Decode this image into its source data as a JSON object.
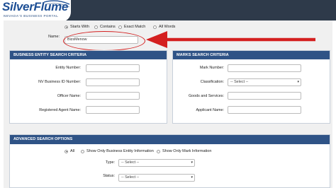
{
  "logo": {
    "title": "SilverFlume",
    "subtitle": "NEVADA'S BUSINESS PORTAL"
  },
  "search_type": {
    "options": [
      "Starts With",
      "Contains",
      "Exact Match",
      "All Words"
    ],
    "selected": "Starts With"
  },
  "name": {
    "label": "Name:",
    "value": "BizsMenow"
  },
  "business_entity": {
    "header": "BUSINESS ENTITY SEARCH CRITERIA",
    "entity_number": "Entity Number:",
    "nv_business_id": "NV Business ID Number:",
    "officer_name": "Officer Name:",
    "registered_agent": "Registered Agent Name:"
  },
  "marks": {
    "header": "MARKS SEARCH CRITERIA",
    "mark_number": "Mark Number:",
    "classification": "Classification:",
    "classification_value": "-- Select --",
    "goods_services": "Goods and Services:",
    "applicant_name": "Applicant Name:"
  },
  "advanced": {
    "header": "ADVANCED SEARCH OPTIONS",
    "options": [
      "All",
      "Show Only Business Entity Information",
      "Show Only Mark Information"
    ],
    "selected": "All",
    "type_label": "Type:",
    "type_value": "-- Select --",
    "status_label": "Status:",
    "status_value": "-- Select --"
  },
  "annotation": {
    "color": "#d42020"
  }
}
